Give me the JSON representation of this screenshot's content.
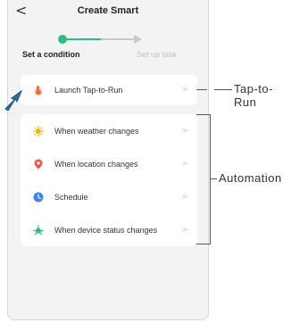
{
  "header": {
    "back_glyph": "<",
    "title": "Create Smart"
  },
  "stepper": {
    "step1_label": "Set a condition",
    "step2_label": "Set up task",
    "active_color": "#2fbd7a",
    "inactive_color": "#c8c8c8"
  },
  "tap_card": {
    "items": [
      {
        "label": "Launch Tap-to-Run",
        "icon": "hand-tap-icon",
        "chevron": ">"
      }
    ]
  },
  "automation_card": {
    "items": [
      {
        "label": "When weather changes",
        "icon": "sun-icon",
        "chevron": ">"
      },
      {
        "label": "When location changes",
        "icon": "location-pin-icon",
        "chevron": ">"
      },
      {
        "label": "Schedule",
        "icon": "clock-icon",
        "chevron": ">"
      },
      {
        "label": "When device status changes",
        "icon": "device-icon",
        "chevron": ">"
      }
    ]
  },
  "annotations": {
    "tap_to_run": "Tap-to-Run",
    "automation": "Automation"
  }
}
